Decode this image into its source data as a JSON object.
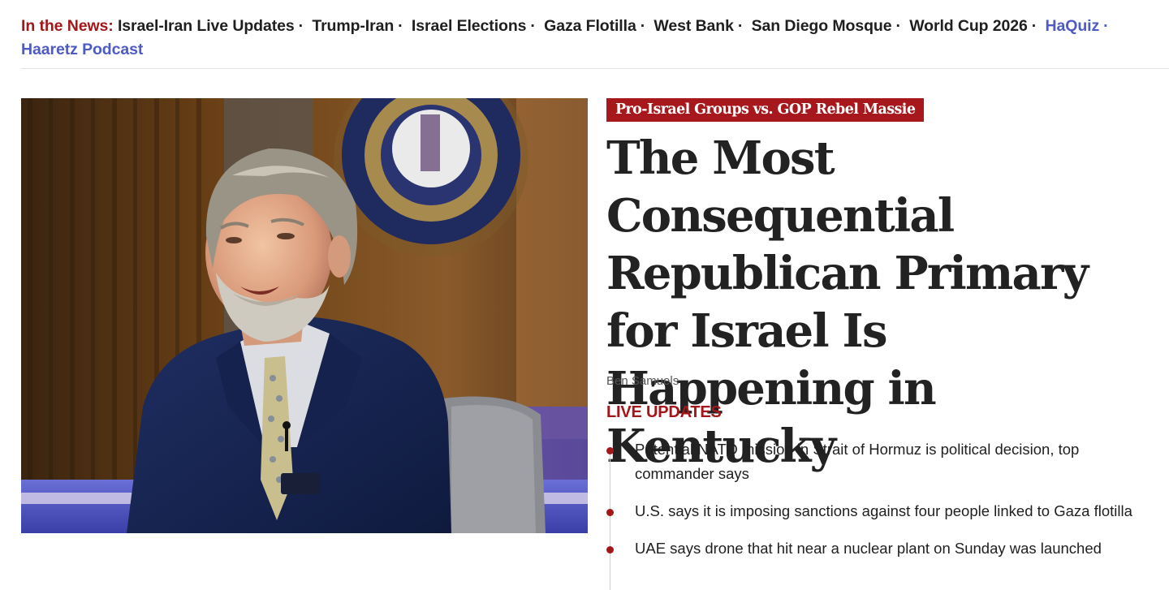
{
  "nav": {
    "lead": "In the News:",
    "links": [
      {
        "label": "Israel-Iran Live Updates",
        "style": "dark"
      },
      {
        "label": "Trump-Iran",
        "style": "dark"
      },
      {
        "label": "Israel Elections",
        "style": "dark"
      },
      {
        "label": "Gaza Flotilla",
        "style": "dark"
      },
      {
        "label": "West Bank",
        "style": "dark"
      },
      {
        "label": "San Diego Mosque",
        "style": "dark"
      },
      {
        "label": "World Cup 2026",
        "style": "dark"
      },
      {
        "label": "HaQuiz",
        "style": "blue"
      },
      {
        "label": "Haaretz Podcast",
        "style": "blue"
      }
    ],
    "separator": "·"
  },
  "article": {
    "kicker": "Pro-Israel Groups vs. GOP Rebel Massie",
    "headline": "The Most Consequential Republican Primary for Israel Is Happening in Kentucky",
    "byline": "Ben Samuels"
  },
  "live": {
    "label": "LIVE UPDATES",
    "items": [
      "Potential NATO mission in Strait of Hormuz is political decision, top commander says",
      "U.S. says it is imposing sanctions against four people linked to Gaza flotilla",
      "UAE says drone that hit near a nuclear plant on Sunday was launched"
    ]
  },
  "colors": {
    "accent_red": "#a4161a",
    "kicker_bg": "#a7181c",
    "link_blue": "#4e5bc4",
    "text_dark": "#1f1f1f",
    "headline": "#222222",
    "byline": "#555555"
  }
}
